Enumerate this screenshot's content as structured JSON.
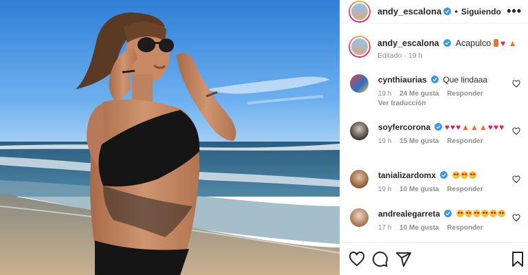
{
  "post": {
    "author": "andy_escalona",
    "follow_label": "Siguiendo",
    "more_label": "•••",
    "caption": "Acapulco",
    "caption_emojis": [
      "bikini-emoji",
      "red-heart-emoji",
      "fire-emoji"
    ],
    "edited": "Editado · 19 h"
  },
  "comments": [
    {
      "user": "cynthiaurias",
      "text": "Que lindaaa",
      "time": "19 h",
      "likes": "24 Me gusta",
      "reply": "Responder",
      "translate": "Ver traducción"
    },
    {
      "user": "soyfercorona",
      "emojis": "hearts and fire",
      "time": "19 h",
      "likes": "15 Me gusta",
      "reply": "Responder"
    },
    {
      "user": "tanializardomx",
      "emojis": "star-struck",
      "time": "19 h",
      "likes": "10 Me gusta",
      "reply": "Responder"
    },
    {
      "user": "andrealegarreta",
      "emojis": "star-struck",
      "time": "17 h",
      "likes": "10 Me gusta",
      "reply": "Responder"
    }
  ],
  "colors": {
    "verified": "#3897f0",
    "heart": "#e0245e",
    "muted": "#8e8e8e"
  },
  "icons": [
    "heart-icon",
    "comment-icon",
    "share-icon",
    "bookmark-icon",
    "verified-icon",
    "more-icon"
  ]
}
